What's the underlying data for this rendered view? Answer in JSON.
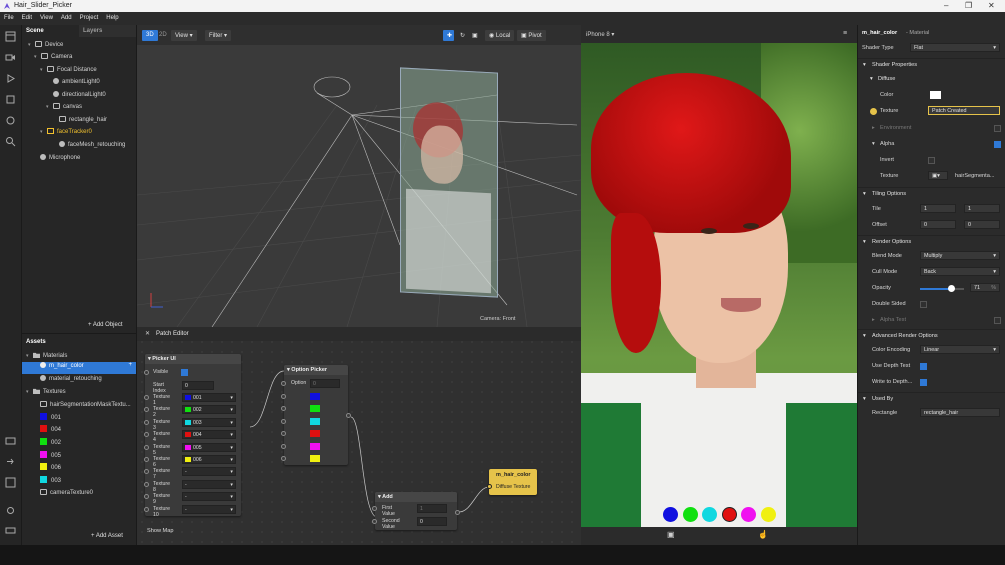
{
  "window": {
    "title": "Hair_Slider_Picker"
  },
  "menu": [
    "File",
    "Edit",
    "View",
    "Add",
    "Project",
    "Help"
  ],
  "scene": {
    "tabs": [
      "Scene",
      "Layers"
    ],
    "tree": [
      "Device",
      "Camera",
      "Focal Distance",
      "ambientLight0",
      "directionalLight0",
      "canvas",
      "rectangle_hair",
      "faceTracker0",
      "faceMesh_retouching",
      "Microphone"
    ],
    "add_object": "+ Add Object"
  },
  "assets": {
    "title": "Assets",
    "materials_label": "Materials",
    "materials": [
      "m_hair_color",
      "material_retouching"
    ],
    "textures_label": "Textures",
    "textures": [
      "hairSegmentationMaskTextu...",
      "001",
      "004",
      "002",
      "005",
      "006",
      "003",
      "cameraTexture0"
    ],
    "add_asset": "+ Add Asset"
  },
  "viewport": {
    "buttons": {
      "mode3d": "3D",
      "mode2d": "2D",
      "view": "View",
      "filter": "Filter",
      "local": "Local",
      "pivot": "Pivot"
    },
    "camera_label": "Camera: Front"
  },
  "preview": {
    "device": "iPhone 8",
    "picker_colors": [
      "#1010e0",
      "#10e010",
      "#10d8e0",
      "#e01010",
      "#f010f0",
      "#f0f010"
    ]
  },
  "patch": {
    "title": "Patch Editor",
    "show_map": "Show Map",
    "picker_ui": {
      "title": "Picker UI",
      "visible": "Visible",
      "start_index": "Start Index",
      "start_value": "0",
      "textures": [
        {
          "label": "Texture 1",
          "value": "001",
          "color": "#1010e0"
        },
        {
          "label": "Texture 2",
          "value": "002",
          "color": "#10e010"
        },
        {
          "label": "Texture 3",
          "value": "003",
          "color": "#10d8e0"
        },
        {
          "label": "Texture 4",
          "value": "004",
          "color": "#e01010"
        },
        {
          "label": "Texture 5",
          "value": "005",
          "color": "#f010f0"
        },
        {
          "label": "Texture 6",
          "value": "006",
          "color": "#f0f010"
        },
        {
          "label": "Texture 7",
          "value": "-",
          "color": ""
        },
        {
          "label": "Texture 8",
          "value": "-",
          "color": ""
        },
        {
          "label": "Texture 9",
          "value": "-",
          "color": ""
        },
        {
          "label": "Texture 10",
          "value": "-",
          "color": ""
        }
      ]
    },
    "option_picker": {
      "title": "Option Picker",
      "option": "Option",
      "option_value": "0",
      "colors": [
        "#1010e0",
        "#10e010",
        "#10d8e0",
        "#e01010",
        "#f010f0",
        "#f0f010"
      ]
    },
    "add_node": {
      "title": "Add",
      "first": "First Value",
      "first_value": "1",
      "second": "Second Value",
      "second_value": "0"
    },
    "material_node": {
      "title": "m_hair_color",
      "port": "Diffuse Texture"
    }
  },
  "inspector": {
    "title": "m_hair_color",
    "subtitle": "- Material",
    "shader_type_label": "Shader Type",
    "shader_type": "Flat",
    "shader_properties": "Shader Properties",
    "diffuse": "Diffuse",
    "color": "Color",
    "texture": "Texture",
    "texture_value": "Patch Created",
    "environment": "Environment",
    "alpha": "Alpha",
    "invert": "Invert",
    "alpha_texture": "Texture",
    "alpha_texture_value": "hairSegmenta...",
    "tiling_options": "Tiling Options",
    "tile": "Tile",
    "tile_x": "1",
    "tile_y": "1",
    "offset": "Offset",
    "offset_x": "0",
    "offset_y": "0",
    "render_options": "Render Options",
    "blend_mode": "Blend Mode",
    "blend_mode_value": "Multiply",
    "cull_mode": "Cull Mode",
    "cull_mode_value": "Back",
    "opacity": "Opacity",
    "opacity_value": "71",
    "opacity_unit": "%",
    "double_sided": "Double Sided",
    "alpha_test": "Alpha Test",
    "advanced_render": "Advanced Render Options",
    "color_encoding": "Color Encoding",
    "color_encoding_value": "Linear",
    "use_depth_test": "Use Depth Test",
    "write_to_depth": "Write to Depth...",
    "used_by": "Used By",
    "rectangle": "Rectangle",
    "rectangle_value": "rectangle_hair"
  },
  "colors": {
    "accent": "#2f79d6",
    "selected": "#2f79d6",
    "patch_yellow": "#e6c34a"
  }
}
